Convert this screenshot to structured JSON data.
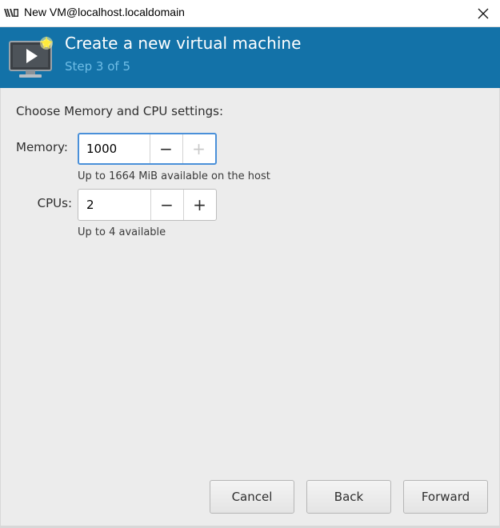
{
  "window": {
    "title": "New VM@localhost.localdomain",
    "app_icon": "virt-manager-icon",
    "close_icon": "close-icon"
  },
  "header": {
    "title": "Create a new virtual machine",
    "step": "Step 3 of 5",
    "icon": "vm-screen-icon",
    "banner_color": "#1372a8"
  },
  "form": {
    "section_label": "Choose Memory and CPU settings:",
    "memory": {
      "label": "Memory:",
      "value": "1000",
      "hint": "Up to 1664 MiB available on the host",
      "minus_symbol": "−",
      "plus_symbol": "+",
      "plus_enabled": false
    },
    "cpus": {
      "label": "CPUs:",
      "value": "2",
      "hint": "Up to 4 available",
      "minus_symbol": "−",
      "plus_symbol": "+",
      "plus_enabled": true
    }
  },
  "buttons": {
    "cancel": "Cancel",
    "back": "Back",
    "forward": "Forward"
  }
}
